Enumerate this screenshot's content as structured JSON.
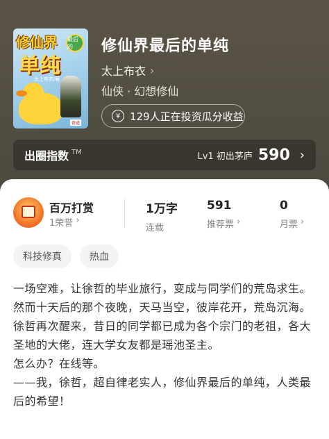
{
  "book": {
    "title": "修仙界最后的单纯",
    "author": "太上布衣",
    "genre": "仙侠 · 幻想修仙",
    "invest_text": "129人正在投资瓜分收益",
    "cover": {
      "title_top": "修仙界",
      "title_bottom": "单纯",
      "tag": "最后的",
      "author": "太上布衣/著",
      "publisher": "奇迹"
    }
  },
  "index_bar": {
    "label": "出圈指数",
    "tm": "TM",
    "level": "Lv1 初出茅庐",
    "score": "590"
  },
  "reward": {
    "name": "百万打赏",
    "sub": "1荣誉"
  },
  "stats": [
    {
      "value": "1万字",
      "label": "连载"
    },
    {
      "value": "591",
      "label": "推荐票"
    },
    {
      "value": "0",
      "label": "月票"
    }
  ],
  "tags": [
    "科技修真",
    "热血"
  ],
  "description": [
    "一场空难，让徐哲的毕业旅行，变成与同学们的荒岛求生。",
    "然而十天后的那个夜晚，天马当空，彼岸花开，荒岛沉海。",
    "徐哲再次醒来，昔日的同学都已成为各个宗门的老祖，各大圣地的大佬，连大学女友都是瑶池圣主。",
    "怎么办？在线等。",
    "——我，徐哲，超自律老实人，修仙界最后的单纯，人类最后的希望！"
  ]
}
